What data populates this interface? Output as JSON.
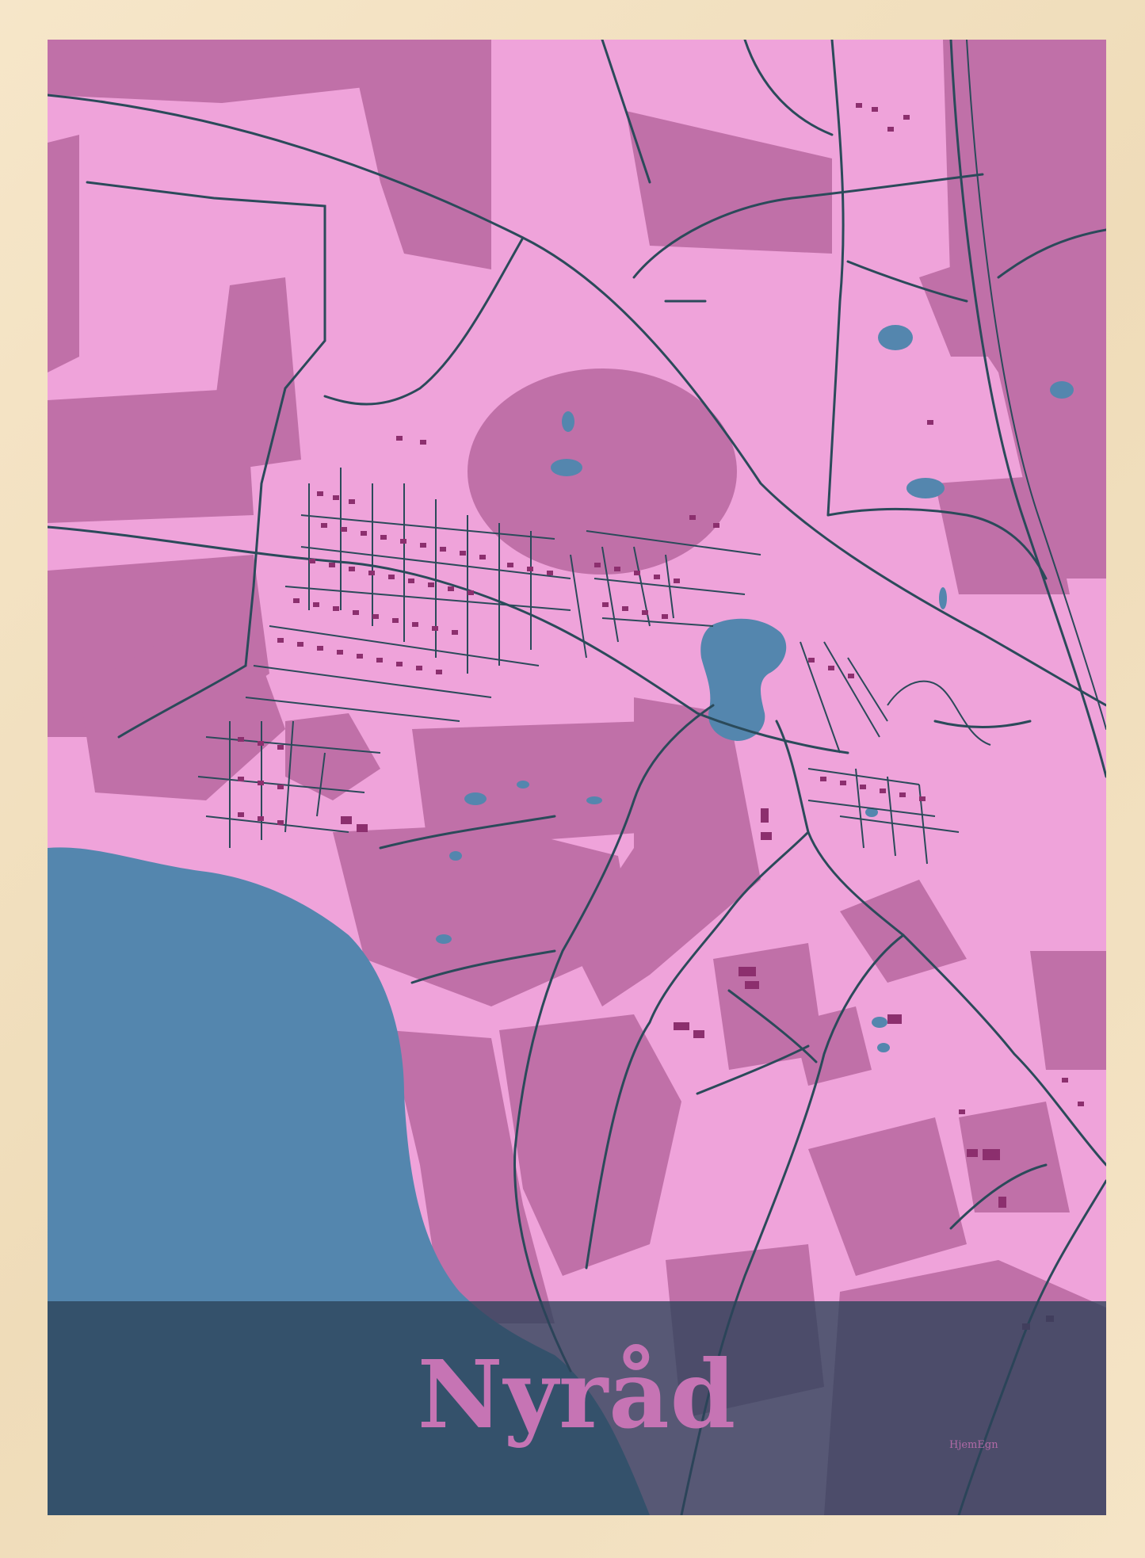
{
  "poster": {
    "title": "Nyråd",
    "brand": "HjemEgn"
  },
  "colors": {
    "frame": "#f3e2c4",
    "land_light": "#efa3da",
    "land_dark": "#c070a8",
    "water": "#5486ae",
    "roads": "#2b4a5a",
    "buildings": "#8c2f6e",
    "title_band": "#2b4259",
    "title_text": "#c674b4"
  },
  "features": {
    "water": [
      "sea",
      "town-lake",
      "ponds"
    ],
    "roads": [
      "railway",
      "main-road",
      "local-streets"
    ]
  }
}
